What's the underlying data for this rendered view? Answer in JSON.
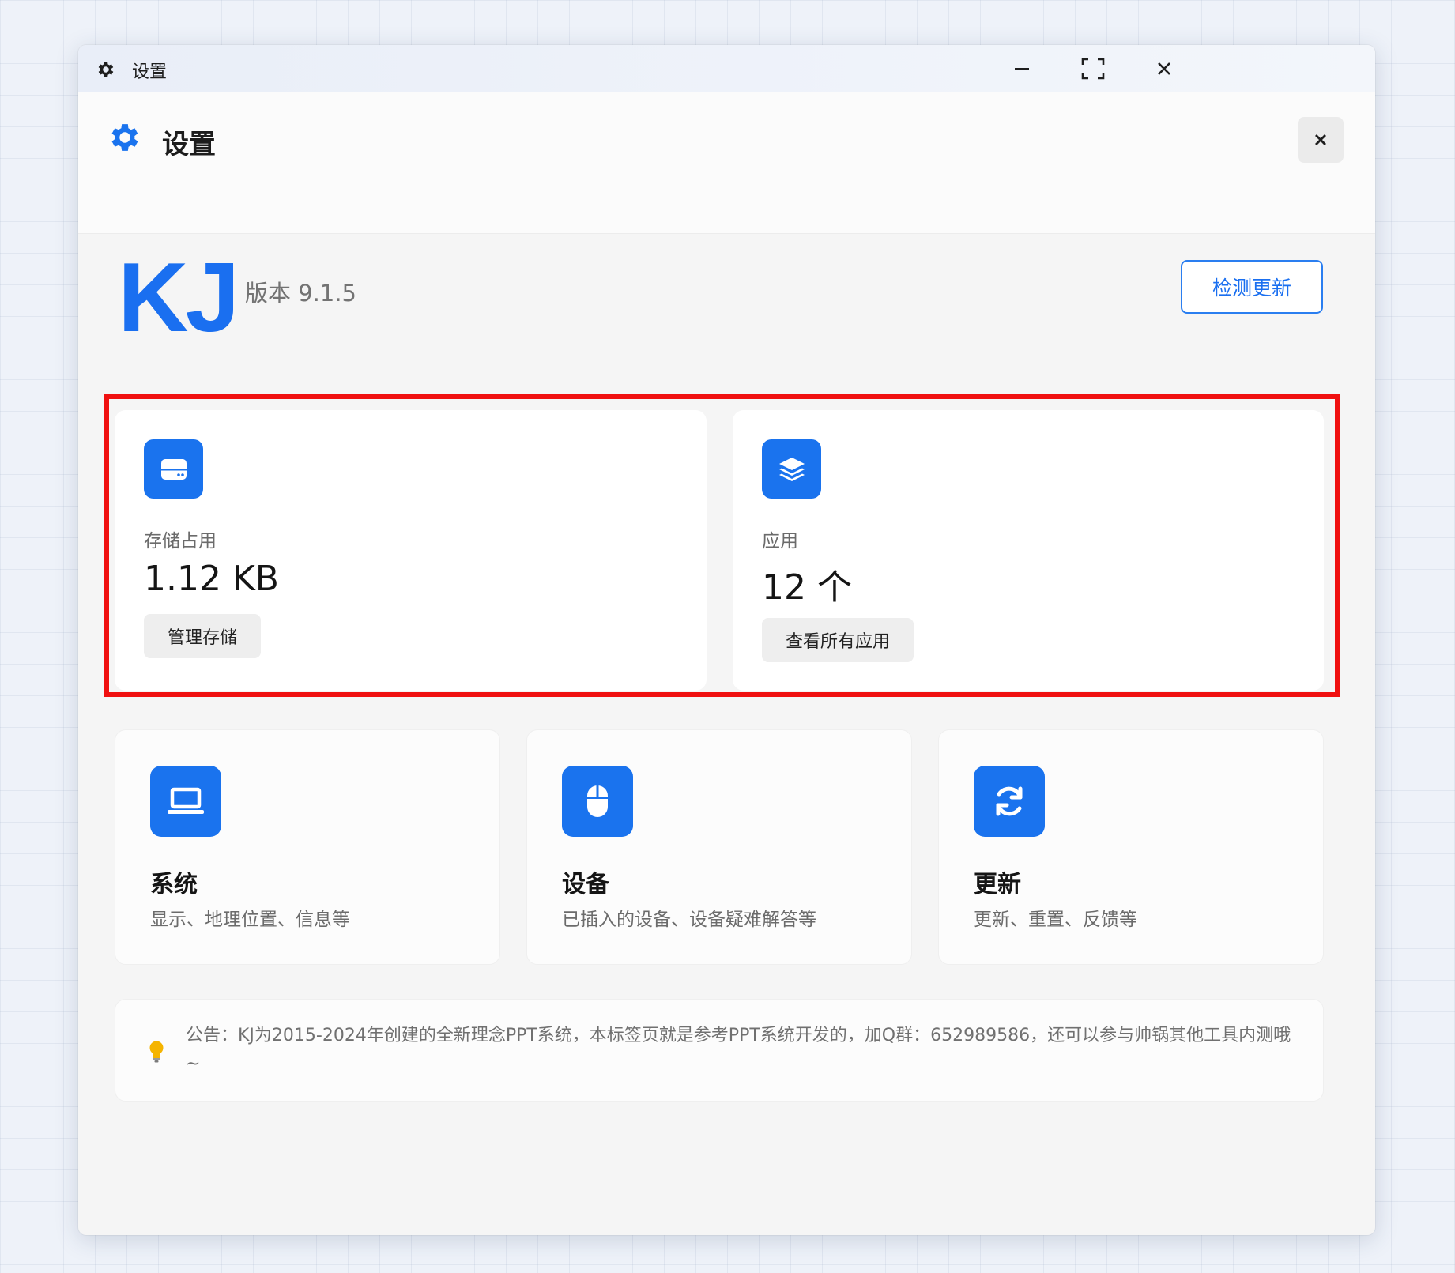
{
  "titlebar": {
    "title": "设置"
  },
  "header": {
    "title": "设置"
  },
  "app": {
    "logo": "KJ",
    "version": "版本 9.1.5",
    "check_update": "检测更新"
  },
  "stats": [
    {
      "label": "存储占用",
      "value": "1.12 KB",
      "button": "管理存储"
    },
    {
      "label": "应用",
      "value": "12 个",
      "button": "查看所有应用"
    }
  ],
  "categories": [
    {
      "title": "系统",
      "desc": "显示、地理位置、信息等"
    },
    {
      "title": "设备",
      "desc": "已插入的设备、设备疑难解答等"
    },
    {
      "title": "更新",
      "desc": "更新、重置、反馈等"
    }
  ],
  "notice": {
    "text": "公告：KJ为2015-2024年创建的全新理念PPT系统，本标签页就是参考PPT系统开发的，加Q群：652989586，还可以参与帅锅其他工具内测哦~"
  },
  "colors": {
    "accent": "#1a73ee",
    "highlight": "#f01010",
    "bulb": "#f5b400"
  }
}
